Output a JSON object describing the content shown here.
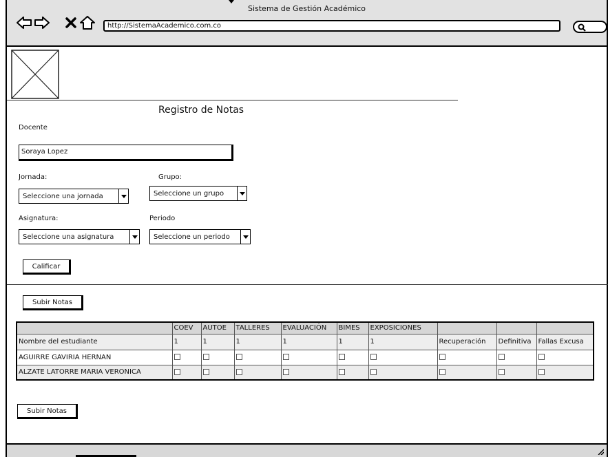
{
  "window": {
    "title": "Sistema de Gestión Académico",
    "url": "http://SistemaAcademico.com.co"
  },
  "icons": {
    "back": "arrow-left-icon",
    "forward": "arrow-right-icon",
    "stop": "close-icon",
    "home": "home-icon",
    "search": "search-icon",
    "placeholder_image": "image-placeholder-icon",
    "resize": "resize-grip-icon"
  },
  "form": {
    "title": "Registro de Notas",
    "docente_label": "Docente",
    "docente_value": "Soraya Lopez",
    "jornada_label": "Jornada:",
    "jornada_value": "Seleccione una jornada",
    "grupo_label": "Grupo:",
    "grupo_value": "Seleccione un grupo",
    "asignatura_label": "Asignatura:",
    "asignatura_value": "Seleccione una asignatura",
    "periodo_label": "Periodo",
    "periodo_value": "Seleccione un periodo",
    "calificar_button": "Calificar"
  },
  "grades": {
    "upload_top_button": "Subir Notas",
    "upload_bottom_button": "Subir Notas",
    "header_row": [
      "",
      "COEV",
      "AUTOE",
      "TALLERES",
      "EVALUACIÓN",
      "BIMES",
      "EXPOSICIONES",
      "",
      "",
      ""
    ],
    "label_row": [
      "Nombre del estudiante",
      "1",
      "1",
      "1",
      "1",
      "1",
      "1",
      "Recuperación",
      "Definitiva",
      "Fallas Excusa"
    ],
    "students": [
      "AGUIRRE GAVIRIA HERNAN",
      "ALZATE LATORRE MARIA VERONICA"
    ]
  },
  "colors": {
    "chrome": "#e2e2e2",
    "border": "#000000",
    "header_fill": "#d6d6d6",
    "row_alt": "#ececec"
  }
}
